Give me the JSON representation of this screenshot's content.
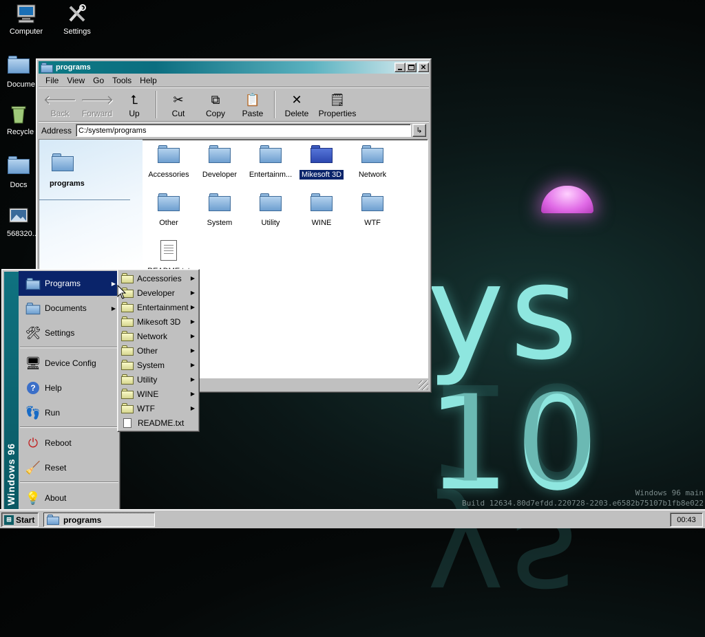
{
  "desktop": {
    "icons": [
      {
        "label": "Computer",
        "icon": "computer-icon"
      },
      {
        "label": "Settings",
        "icon": "settings-icon"
      },
      {
        "label": "Docume",
        "icon": "folder-icon"
      },
      {
        "label": "Recycle",
        "icon": "recycle-bin-icon"
      },
      {
        "label": "Docs",
        "icon": "folder-icon"
      },
      {
        "label": "568320...",
        "icon": "image-file-icon"
      }
    ],
    "wallpaper_text": "ys 10",
    "build_line1": "Windows 96 main",
    "build_line2": "Build 12634.80d7efdd.220728-2203.e6582b75107b1fb8e022"
  },
  "explorer": {
    "title": "programs",
    "menu": [
      "File",
      "View",
      "Go",
      "Tools",
      "Help"
    ],
    "toolbar": {
      "back": "Back",
      "forward": "Forward",
      "up": "Up",
      "cut": "Cut",
      "copy": "Copy",
      "paste": "Paste",
      "delete": "Delete",
      "properties": "Properties"
    },
    "address_label": "Address",
    "address_value": "C:/system/programs",
    "side_panel_title": "programs",
    "items": [
      {
        "label": "Accessories",
        "type": "folder"
      },
      {
        "label": "Developer",
        "type": "folder"
      },
      {
        "label": "Entertainm...",
        "type": "folder"
      },
      {
        "label": "Mikesoft 3D",
        "type": "folder",
        "selected": true
      },
      {
        "label": "Network",
        "type": "folder"
      },
      {
        "label": "Other",
        "type": "folder"
      },
      {
        "label": "System",
        "type": "folder"
      },
      {
        "label": "Utility",
        "type": "folder"
      },
      {
        "label": "WINE",
        "type": "folder"
      },
      {
        "label": "WTF",
        "type": "folder"
      },
      {
        "label": "README.txt",
        "type": "file"
      }
    ]
  },
  "start_menu": {
    "banner": "Windows 96",
    "items": [
      {
        "label": "Programs",
        "icon": "folder-icon",
        "submenu": true,
        "active": true
      },
      {
        "label": "Documents",
        "icon": "folder-icon",
        "submenu": true
      },
      {
        "label": "Settings",
        "icon": "settings-icon"
      },
      {
        "label": "Device Config",
        "icon": "monitor-icon"
      },
      {
        "label": "Help",
        "icon": "help-icon"
      },
      {
        "label": "Run",
        "icon": "run-icon"
      },
      {
        "label": "Reboot",
        "icon": "reboot-icon"
      },
      {
        "label": "Reset",
        "icon": "broom-icon"
      },
      {
        "label": "About",
        "icon": "bulb-icon"
      }
    ]
  },
  "programs_submenu": [
    "Accessories",
    "Developer",
    "Entertainment",
    "Mikesoft 3D",
    "Network",
    "Other",
    "System",
    "Utility",
    "WINE",
    "WTF",
    "README.txt"
  ],
  "taskbar": {
    "start_label": "Start",
    "task_label": "programs",
    "clock": "00:43"
  }
}
